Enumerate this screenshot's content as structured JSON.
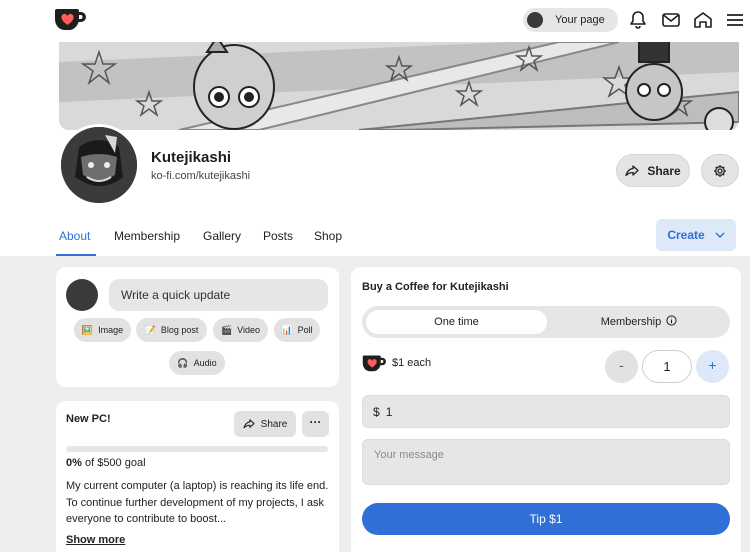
{
  "nav": {
    "your_page_label": "Your page",
    "icons": [
      "bell-icon",
      "mail-icon",
      "home-icon",
      "menu-icon"
    ]
  },
  "profile": {
    "name": "Kutejikashi",
    "url": "ko-fi.com/kutejikashi",
    "share_label": "Share"
  },
  "tabs": [
    {
      "label": "About",
      "active": true
    },
    {
      "label": "Membership",
      "active": false
    },
    {
      "label": "Gallery",
      "active": false
    },
    {
      "label": "Posts",
      "active": false
    },
    {
      "label": "Shop",
      "active": false
    }
  ],
  "create_label": "Create",
  "update": {
    "placeholder": "Write a quick update",
    "chips": [
      {
        "label": "Image",
        "icon": "🖼️"
      },
      {
        "label": "Blog post",
        "icon": "📝"
      },
      {
        "label": "Video",
        "icon": "🎬"
      },
      {
        "label": "Poll",
        "icon": "📊"
      },
      {
        "label": "Audio",
        "icon": "🎧"
      }
    ]
  },
  "goal": {
    "title": "New PC!",
    "share_label": "Share",
    "more_label": "···",
    "percent": "0%",
    "goal_text": "of $500 goal",
    "progress": 0,
    "description": "My current computer (a laptop) is reaching its life end. To continue further development of my projects, I ask everyone to contribute to boost...",
    "show_more": "Show more"
  },
  "coffee": {
    "title": "Buy a Coffee for Kutejikashi",
    "toggle_one_time": "One time",
    "toggle_membership": "Membership",
    "each_label": "$1 each",
    "minus": "-",
    "quantity": "1",
    "plus": "+",
    "currency": "$",
    "amount": "1",
    "message_placeholder": "Your message",
    "tip_label": "Tip $1"
  },
  "colors": {
    "accent": "#2f6fd6",
    "kofi_red": "#ff5e5b"
  }
}
